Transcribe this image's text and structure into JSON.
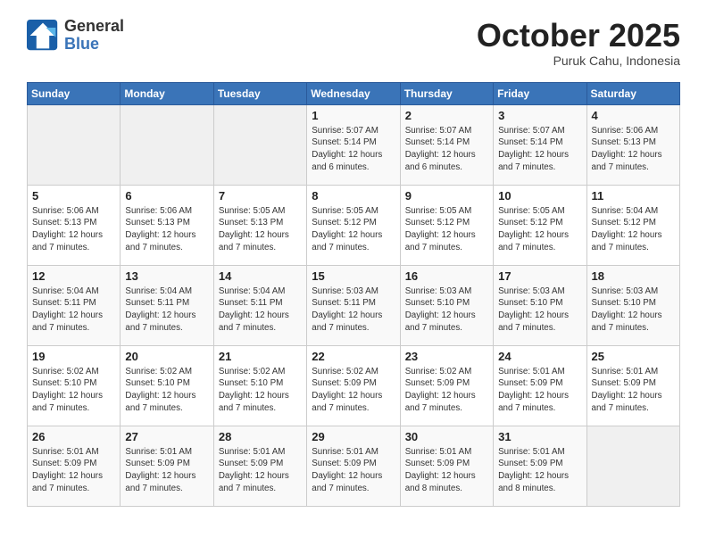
{
  "header": {
    "logo_line1": "General",
    "logo_line2": "Blue",
    "month": "October 2025",
    "location": "Puruk Cahu, Indonesia"
  },
  "days_of_week": [
    "Sunday",
    "Monday",
    "Tuesday",
    "Wednesday",
    "Thursday",
    "Friday",
    "Saturday"
  ],
  "weeks": [
    [
      {
        "day": "",
        "info": ""
      },
      {
        "day": "",
        "info": ""
      },
      {
        "day": "",
        "info": ""
      },
      {
        "day": "1",
        "info": "Sunrise: 5:07 AM\nSunset: 5:14 PM\nDaylight: 12 hours\nand 6 minutes."
      },
      {
        "day": "2",
        "info": "Sunrise: 5:07 AM\nSunset: 5:14 PM\nDaylight: 12 hours\nand 6 minutes."
      },
      {
        "day": "3",
        "info": "Sunrise: 5:07 AM\nSunset: 5:14 PM\nDaylight: 12 hours\nand 7 minutes."
      },
      {
        "day": "4",
        "info": "Sunrise: 5:06 AM\nSunset: 5:13 PM\nDaylight: 12 hours\nand 7 minutes."
      }
    ],
    [
      {
        "day": "5",
        "info": "Sunrise: 5:06 AM\nSunset: 5:13 PM\nDaylight: 12 hours\nand 7 minutes."
      },
      {
        "day": "6",
        "info": "Sunrise: 5:06 AM\nSunset: 5:13 PM\nDaylight: 12 hours\nand 7 minutes."
      },
      {
        "day": "7",
        "info": "Sunrise: 5:05 AM\nSunset: 5:13 PM\nDaylight: 12 hours\nand 7 minutes."
      },
      {
        "day": "8",
        "info": "Sunrise: 5:05 AM\nSunset: 5:12 PM\nDaylight: 12 hours\nand 7 minutes."
      },
      {
        "day": "9",
        "info": "Sunrise: 5:05 AM\nSunset: 5:12 PM\nDaylight: 12 hours\nand 7 minutes."
      },
      {
        "day": "10",
        "info": "Sunrise: 5:05 AM\nSunset: 5:12 PM\nDaylight: 12 hours\nand 7 minutes."
      },
      {
        "day": "11",
        "info": "Sunrise: 5:04 AM\nSunset: 5:12 PM\nDaylight: 12 hours\nand 7 minutes."
      }
    ],
    [
      {
        "day": "12",
        "info": "Sunrise: 5:04 AM\nSunset: 5:11 PM\nDaylight: 12 hours\nand 7 minutes."
      },
      {
        "day": "13",
        "info": "Sunrise: 5:04 AM\nSunset: 5:11 PM\nDaylight: 12 hours\nand 7 minutes."
      },
      {
        "day": "14",
        "info": "Sunrise: 5:04 AM\nSunset: 5:11 PM\nDaylight: 12 hours\nand 7 minutes."
      },
      {
        "day": "15",
        "info": "Sunrise: 5:03 AM\nSunset: 5:11 PM\nDaylight: 12 hours\nand 7 minutes."
      },
      {
        "day": "16",
        "info": "Sunrise: 5:03 AM\nSunset: 5:10 PM\nDaylight: 12 hours\nand 7 minutes."
      },
      {
        "day": "17",
        "info": "Sunrise: 5:03 AM\nSunset: 5:10 PM\nDaylight: 12 hours\nand 7 minutes."
      },
      {
        "day": "18",
        "info": "Sunrise: 5:03 AM\nSunset: 5:10 PM\nDaylight: 12 hours\nand 7 minutes."
      }
    ],
    [
      {
        "day": "19",
        "info": "Sunrise: 5:02 AM\nSunset: 5:10 PM\nDaylight: 12 hours\nand 7 minutes."
      },
      {
        "day": "20",
        "info": "Sunrise: 5:02 AM\nSunset: 5:10 PM\nDaylight: 12 hours\nand 7 minutes."
      },
      {
        "day": "21",
        "info": "Sunrise: 5:02 AM\nSunset: 5:10 PM\nDaylight: 12 hours\nand 7 minutes."
      },
      {
        "day": "22",
        "info": "Sunrise: 5:02 AM\nSunset: 5:09 PM\nDaylight: 12 hours\nand 7 minutes."
      },
      {
        "day": "23",
        "info": "Sunrise: 5:02 AM\nSunset: 5:09 PM\nDaylight: 12 hours\nand 7 minutes."
      },
      {
        "day": "24",
        "info": "Sunrise: 5:01 AM\nSunset: 5:09 PM\nDaylight: 12 hours\nand 7 minutes."
      },
      {
        "day": "25",
        "info": "Sunrise: 5:01 AM\nSunset: 5:09 PM\nDaylight: 12 hours\nand 7 minutes."
      }
    ],
    [
      {
        "day": "26",
        "info": "Sunrise: 5:01 AM\nSunset: 5:09 PM\nDaylight: 12 hours\nand 7 minutes."
      },
      {
        "day": "27",
        "info": "Sunrise: 5:01 AM\nSunset: 5:09 PM\nDaylight: 12 hours\nand 7 minutes."
      },
      {
        "day": "28",
        "info": "Sunrise: 5:01 AM\nSunset: 5:09 PM\nDaylight: 12 hours\nand 7 minutes."
      },
      {
        "day": "29",
        "info": "Sunrise: 5:01 AM\nSunset: 5:09 PM\nDaylight: 12 hours\nand 7 minutes."
      },
      {
        "day": "30",
        "info": "Sunrise: 5:01 AM\nSunset: 5:09 PM\nDaylight: 12 hours\nand 8 minutes."
      },
      {
        "day": "31",
        "info": "Sunrise: 5:01 AM\nSunset: 5:09 PM\nDaylight: 12 hours\nand 8 minutes."
      },
      {
        "day": "",
        "info": ""
      }
    ]
  ]
}
